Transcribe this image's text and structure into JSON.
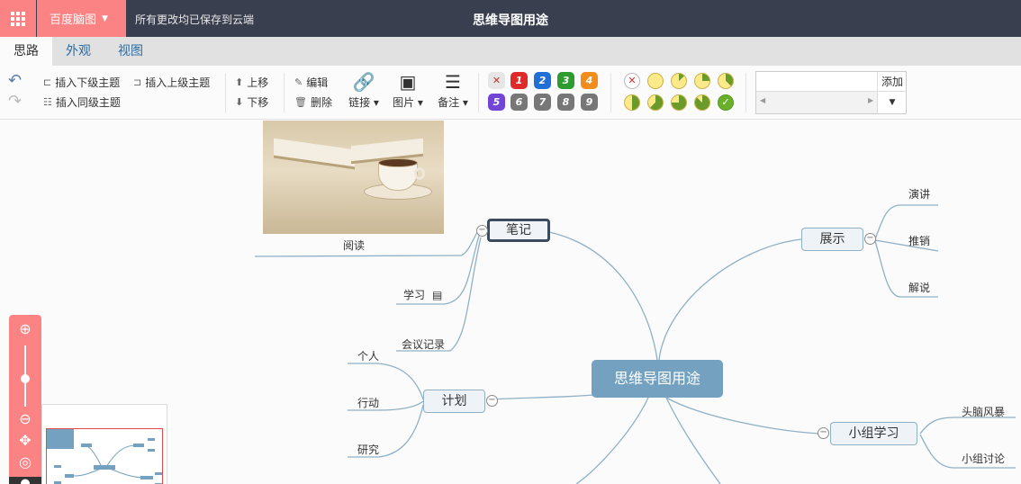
{
  "app": {
    "brand": "百度脑图",
    "save_status": "所有更改均已保存到云端",
    "document_title": "思维导图用途"
  },
  "tabs": [
    {
      "label": "思路",
      "active": true
    },
    {
      "label": "外观",
      "active": false
    },
    {
      "label": "视图",
      "active": false
    }
  ],
  "toolbar": {
    "insert_child": "插入下级主题",
    "insert_parent": "插入上级主题",
    "insert_sibling": "插入同级主题",
    "move_up": "上移",
    "move_down": "下移",
    "edit": "编辑",
    "delete": "删除",
    "link": "链接",
    "image": "图片",
    "note": "备注",
    "priorities": [
      "1",
      "2",
      "3",
      "4",
      "5",
      "6",
      "7",
      "8",
      "9"
    ],
    "resource_add": "添加"
  },
  "colors": {
    "titlebar": "#393f4f",
    "accent": "#fc8383",
    "root_node": "#73a1bf",
    "line": "#8fb0c6"
  },
  "mindmap": {
    "root": "思维导图用途",
    "notes": {
      "label": "笔记",
      "image_caption": "阅读",
      "children": [
        "学习",
        "会议记录"
      ]
    },
    "plan": {
      "label": "计划",
      "children": [
        "个人",
        "行动",
        "研究"
      ]
    },
    "show": {
      "label": "展示",
      "children": [
        "演讲",
        "推销",
        "解说"
      ]
    },
    "group": {
      "label": "小组学习",
      "children": [
        "头脑风暴",
        "小组讨论"
      ]
    }
  }
}
